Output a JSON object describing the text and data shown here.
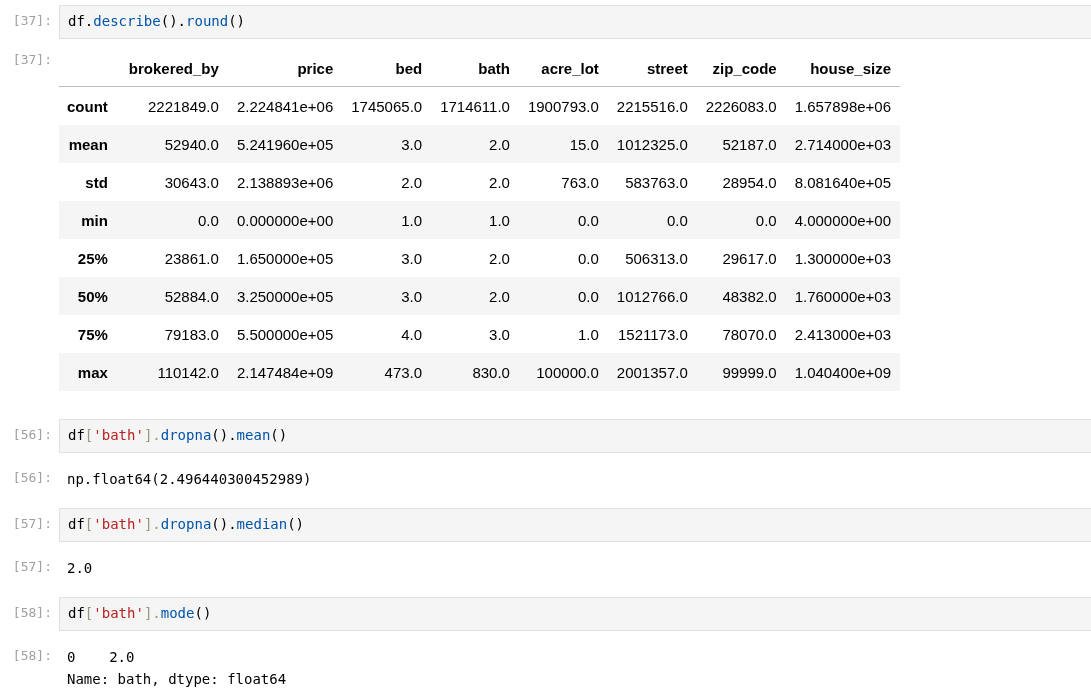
{
  "cells": [
    {
      "kind": "code",
      "prompt": "[37]:",
      "tokens": [
        {
          "text": "df.",
          "kind": "name"
        },
        {
          "text": "describe",
          "kind": "prop"
        },
        {
          "text": "().",
          "kind": "paren"
        },
        {
          "text": "round",
          "kind": "prop"
        },
        {
          "text": "()",
          "kind": "paren"
        }
      ]
    },
    {
      "kind": "table",
      "prompt": "[37]:",
      "columns": [
        "brokered_by",
        "price",
        "bed",
        "bath",
        "acre_lot",
        "street",
        "zip_code",
        "house_size"
      ],
      "rows": [
        {
          "index": "count",
          "values": [
            "2221849.0",
            "2.224841e+06",
            "1745065.0",
            "1714611.0",
            "1900793.0",
            "2215516.0",
            "2226083.0",
            "1.657898e+06"
          ]
        },
        {
          "index": "mean",
          "values": [
            "52940.0",
            "5.241960e+05",
            "3.0",
            "2.0",
            "15.0",
            "1012325.0",
            "52187.0",
            "2.714000e+03"
          ]
        },
        {
          "index": "std",
          "values": [
            "30643.0",
            "2.138893e+06",
            "2.0",
            "2.0",
            "763.0",
            "583763.0",
            "28954.0",
            "8.081640e+05"
          ]
        },
        {
          "index": "min",
          "values": [
            "0.0",
            "0.000000e+00",
            "1.0",
            "1.0",
            "0.0",
            "0.0",
            "0.0",
            "4.000000e+00"
          ]
        },
        {
          "index": "25%",
          "values": [
            "23861.0",
            "1.650000e+05",
            "3.0",
            "2.0",
            "0.0",
            "506313.0",
            "29617.0",
            "1.300000e+03"
          ]
        },
        {
          "index": "50%",
          "values": [
            "52884.0",
            "3.250000e+05",
            "3.0",
            "2.0",
            "0.0",
            "1012766.0",
            "48382.0",
            "1.760000e+03"
          ]
        },
        {
          "index": "75%",
          "values": [
            "79183.0",
            "5.500000e+05",
            "4.0",
            "3.0",
            "1.0",
            "1521173.0",
            "78070.0",
            "2.413000e+03"
          ]
        },
        {
          "index": "max",
          "values": [
            "110142.0",
            "2.147484e+09",
            "473.0",
            "830.0",
            "100000.0",
            "2001357.0",
            "99999.0",
            "1.040400e+09"
          ]
        }
      ]
    },
    {
      "kind": "code",
      "prompt": "[56]:",
      "tokens": [
        {
          "text": "df",
          "kind": "name"
        },
        {
          "text": "[",
          "kind": "bracket"
        },
        {
          "text": "'bath'",
          "kind": "string"
        },
        {
          "text": "].",
          "kind": "bracket"
        },
        {
          "text": "dropna",
          "kind": "prop"
        },
        {
          "text": "().",
          "kind": "paren"
        },
        {
          "text": "mean",
          "kind": "prop"
        },
        {
          "text": "()",
          "kind": "paren"
        }
      ]
    },
    {
      "kind": "text",
      "prompt": "[56]:",
      "lines": [
        "np.float64(2.496440300452989)"
      ]
    },
    {
      "kind": "code",
      "prompt": "[57]:",
      "tokens": [
        {
          "text": "df",
          "kind": "name"
        },
        {
          "text": "[",
          "kind": "bracket"
        },
        {
          "text": "'bath'",
          "kind": "string"
        },
        {
          "text": "].",
          "kind": "bracket"
        },
        {
          "text": "dropna",
          "kind": "prop"
        },
        {
          "text": "().",
          "kind": "paren"
        },
        {
          "text": "median",
          "kind": "prop"
        },
        {
          "text": "()",
          "kind": "paren"
        }
      ]
    },
    {
      "kind": "text",
      "prompt": "[57]:",
      "lines": [
        "2.0"
      ]
    },
    {
      "kind": "code",
      "prompt": "[58]:",
      "tokens": [
        {
          "text": "df",
          "kind": "name"
        },
        {
          "text": "[",
          "kind": "bracket"
        },
        {
          "text": "'bath'",
          "kind": "string"
        },
        {
          "text": "].",
          "kind": "bracket"
        },
        {
          "text": "mode",
          "kind": "prop"
        },
        {
          "text": "()",
          "kind": "paren"
        }
      ]
    },
    {
      "kind": "text",
      "prompt": "[58]:",
      "lines": [
        "0    2.0",
        "Name: bath, dtype: float64"
      ]
    }
  ]
}
